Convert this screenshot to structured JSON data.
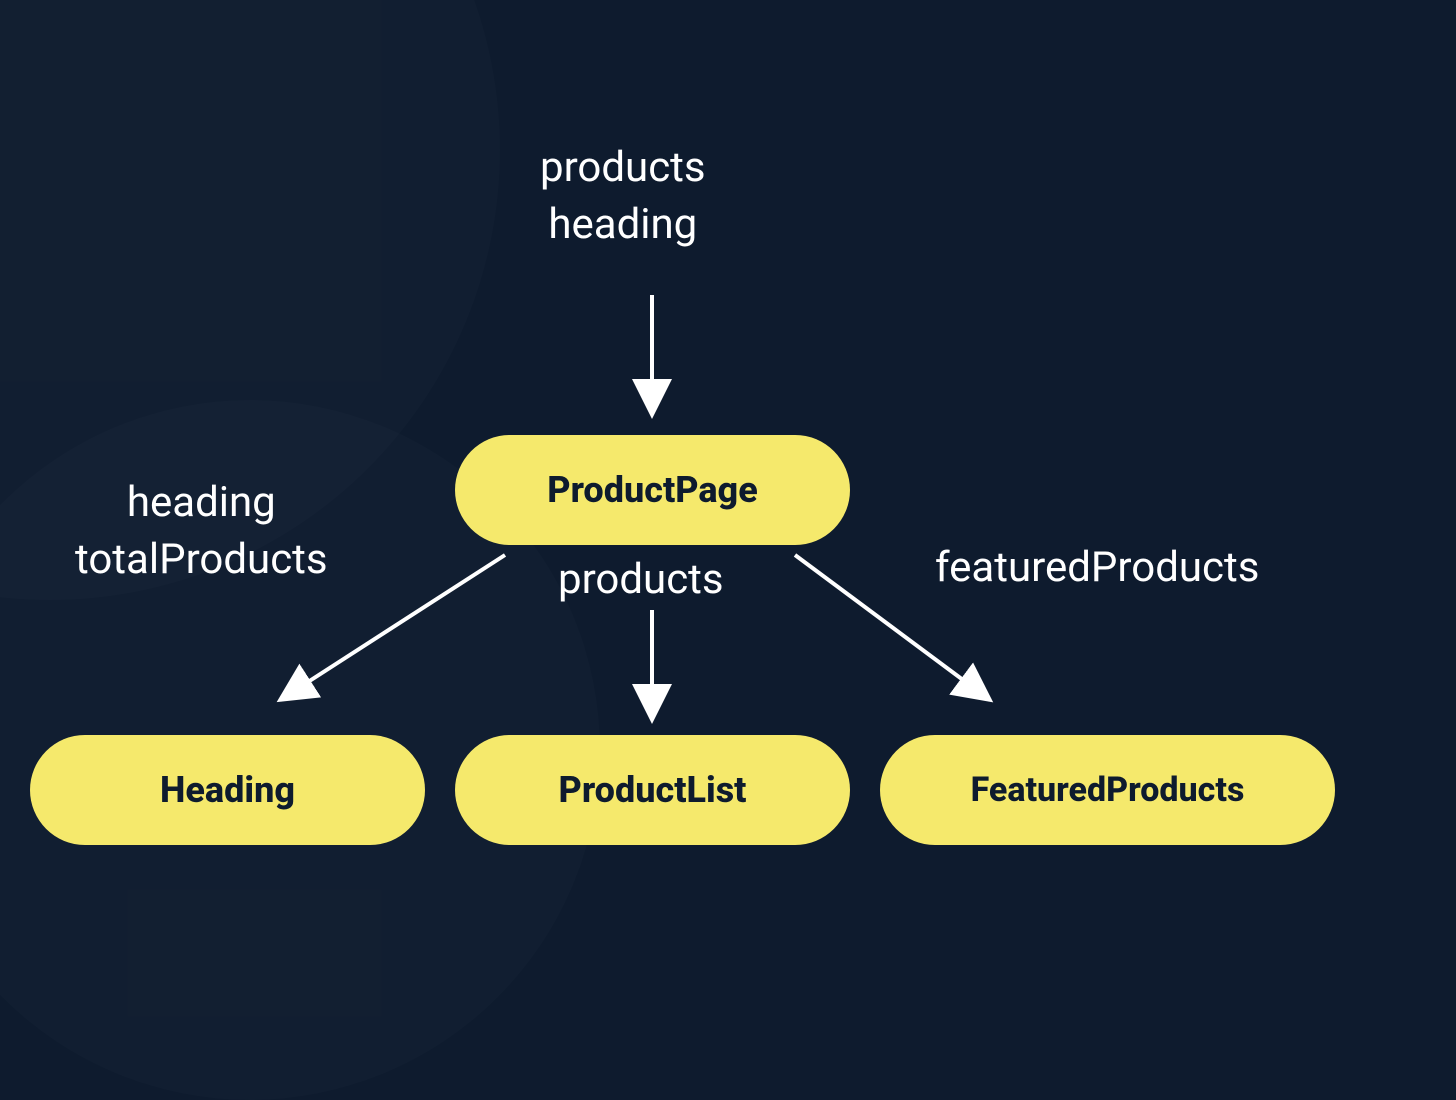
{
  "nodes": {
    "root": "ProductPage",
    "child_left": "Heading",
    "child_mid": "ProductList",
    "child_right": "FeaturedProducts"
  },
  "labels": {
    "top_props_line1": "products",
    "top_props_line2": "heading",
    "left_props_line1": "heading",
    "left_props_line2": "totalProducts",
    "mid_props": "products",
    "right_props": "featuredProducts"
  }
}
